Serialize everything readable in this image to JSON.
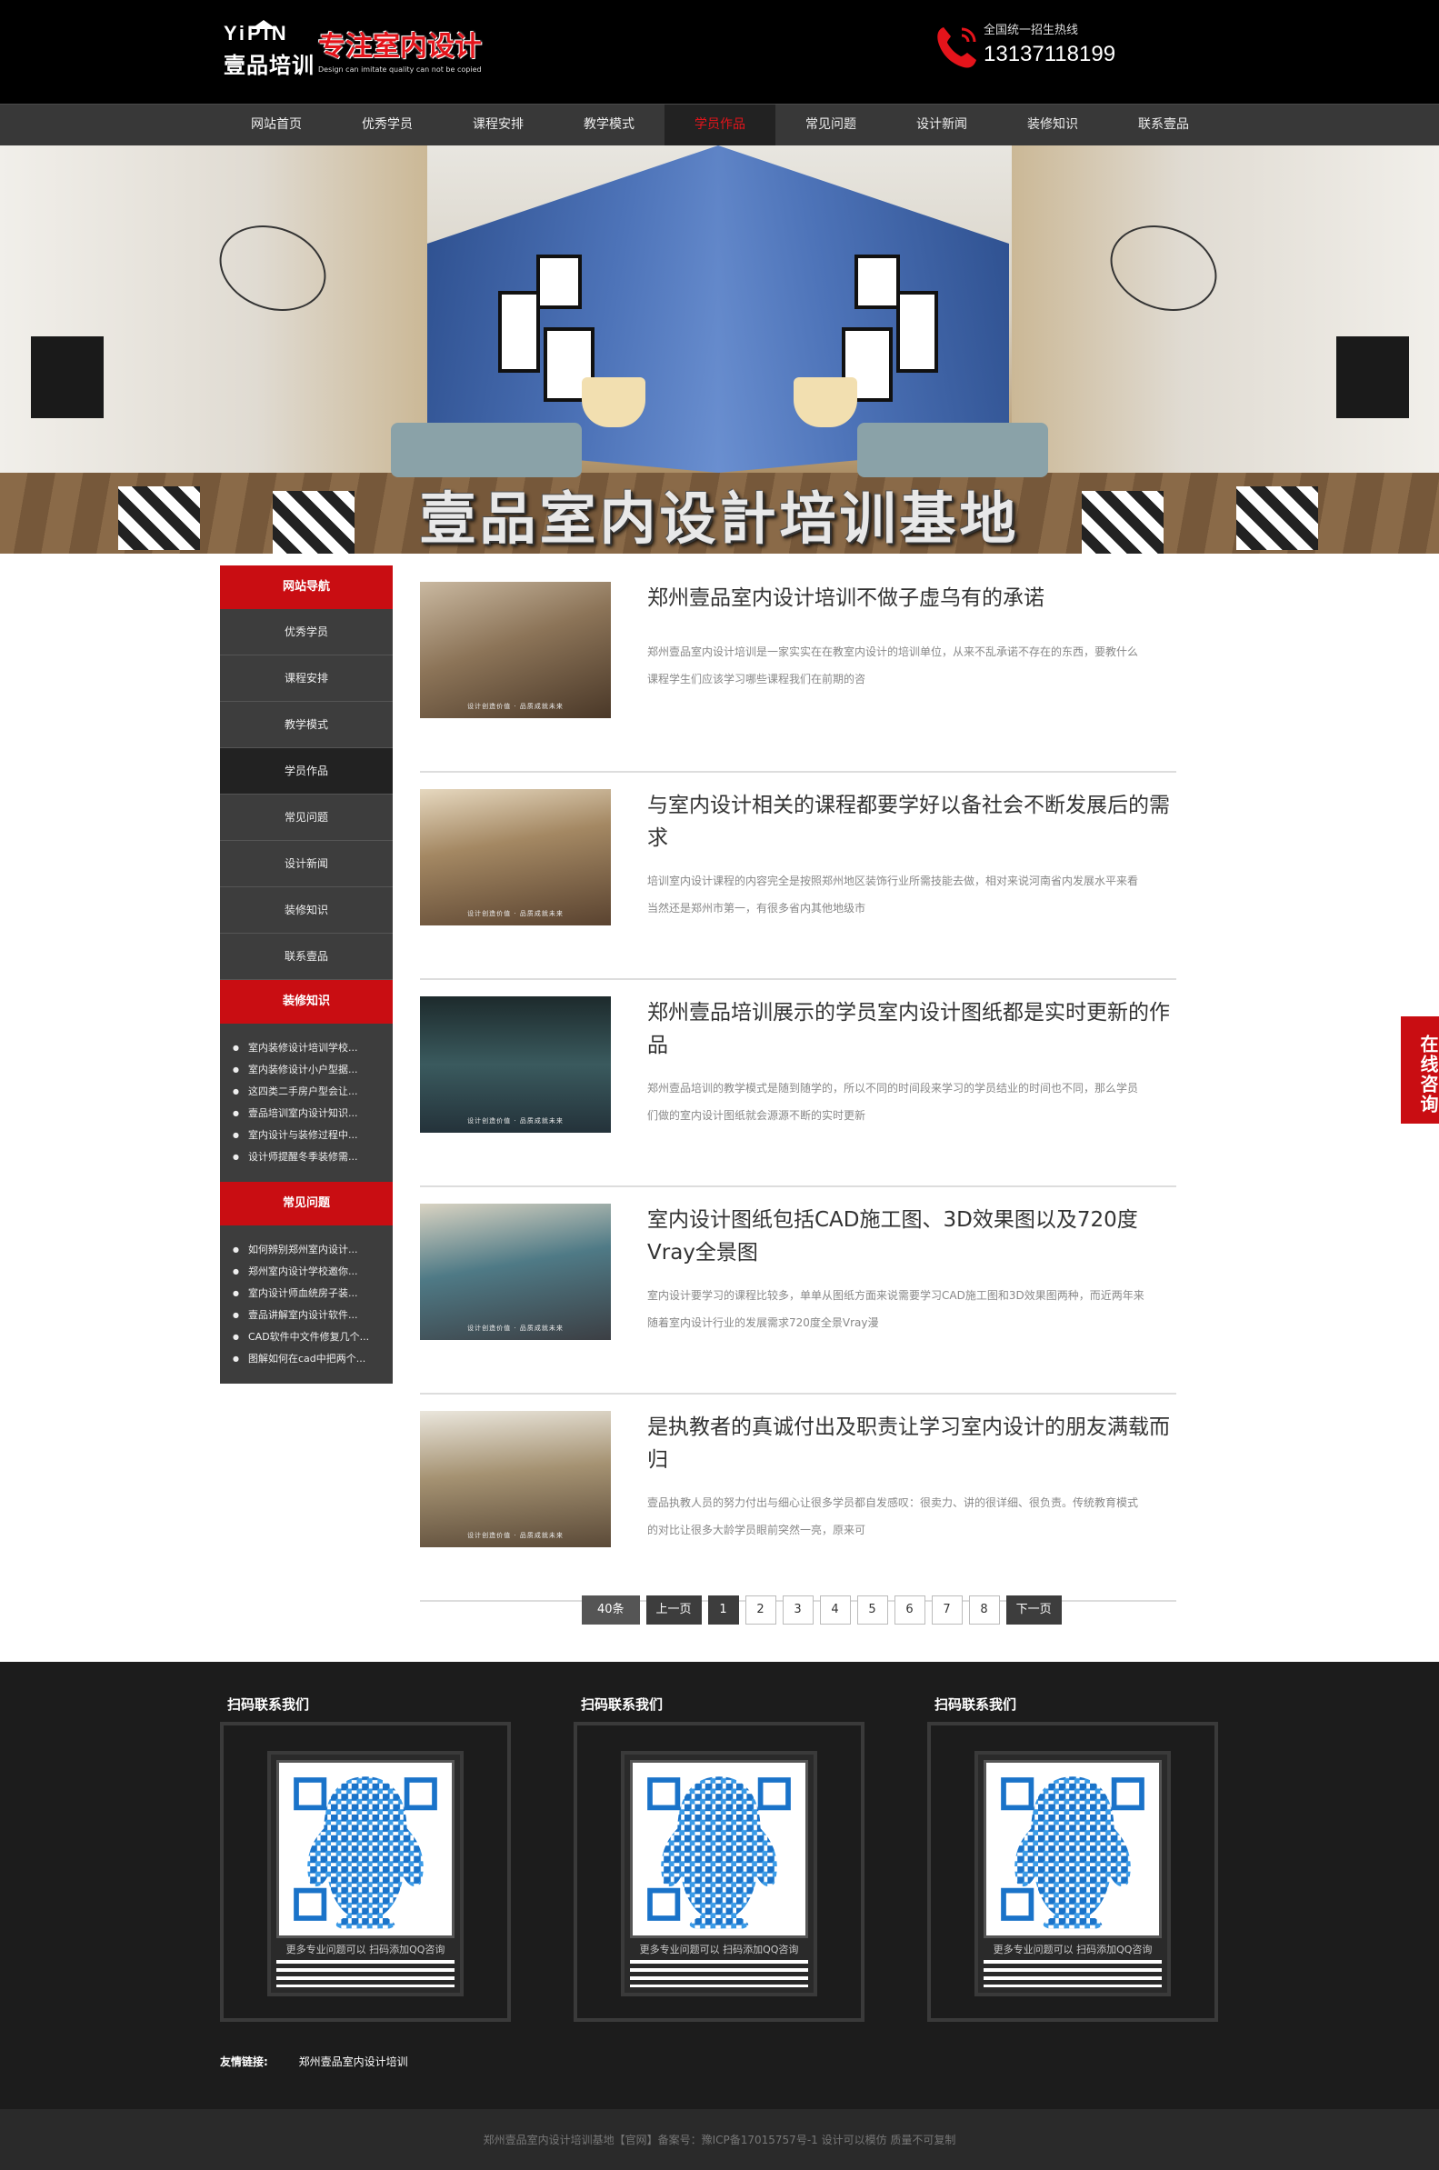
{
  "header": {
    "logo_yp": "YiPiN",
    "logo_cn": "壹品培训",
    "logo_slogan": "专注室内设计",
    "logo_en": "Design can imitate quality can not be copied",
    "hotline_label": "全国统一招生热线",
    "hotline_number": "13137118199"
  },
  "nav": {
    "items": [
      "网站首页",
      "优秀学员",
      "课程安排",
      "教学模式",
      "学员作品",
      "常见问题",
      "设计新闻",
      "装修知识",
      "联系壹品"
    ],
    "active": 4
  },
  "banner": {
    "title": "壹品室内设計培训基地"
  },
  "sidebar": {
    "nav_head": "网站导航",
    "nav_items": [
      "优秀学员",
      "课程安排",
      "教学模式",
      "学员作品",
      "常见问题",
      "设计新闻",
      "装修知识",
      "联系壹品"
    ],
    "nav_active": 3,
    "knowledge_head": "装修知识",
    "knowledge_items": [
      "室内装修设计培训学校...",
      "室内装修设计小户型据...",
      "这四类二手房户型会让...",
      "壹品培训室内设计知识...",
      "室内设计与装修过程中...",
      "设计师提醒冬季装修需..."
    ],
    "faq_head": "常见问题",
    "faq_items": [
      "如何辨别郑州室内设计...",
      "郑州室内设计学校邀你...",
      "室内设计师血统房子装...",
      "壹品讲解室内设计软件...",
      "CAD软件中文件修复几个...",
      "图解如何在cad中把两个..."
    ]
  },
  "articles": [
    {
      "title": "郑州壹品室内设计培训不做子虚乌有的承诺",
      "desc": "郑州壹品室内设计培训是一家实实在在教室内设计的培训单位，从来不乱承诺不存在的东西，要教什么课程学生们应该学习哪些课程我们在前期的咨",
      "thumb_caption": "设计创造价值 · 品质成就未来"
    },
    {
      "title": "与室内设计相关的课程都要学好以备社会不断发展后的需求",
      "desc": "培训室内设计课程的内容完全是按照郑州地区装饰行业所需技能去做，相对来说河南省内发展水平来看当然还是郑州市第一，有很多省内其他地级市",
      "thumb_caption": "设计创造价值 · 品质成就未来"
    },
    {
      "title": "郑州壹品培训展示的学员室内设计图纸都是实时更新的作品",
      "desc": "郑州壹品培训的教学模式是随到随学的，所以不同的时间段来学习的学员结业的时间也不同，那么学员们做的室内设计图纸就会源源不断的实时更新",
      "thumb_caption": "设计创造价值 · 品质成就未来"
    },
    {
      "title": "室内设计图纸包括CAD施工图、3D效果图以及720度Vray全景图",
      "desc": "室内设计要学习的课程比较多，单单从图纸方面来说需要学习CAD施工图和3D效果图两种，而近两年来随着室内设计行业的发展需求720度全景Vray漫",
      "thumb_caption": "设计创造价值 · 品质成就未来"
    },
    {
      "title": "是执教者的真诚付出及职责让学习室内设计的朋友满载而归",
      "desc": "壹品执教人员的努力付出与细心让很多学员都自发感叹：很卖力、讲的很详细、很负责。传统教育模式的对比让很多大龄学员眼前突然一亮，原来可",
      "thumb_caption": "设计创造价值 · 品质成就未来"
    }
  ],
  "pager": {
    "total": "40条",
    "prev": "上一页",
    "pages": [
      "1",
      "2",
      "3",
      "4",
      "5",
      "6",
      "7",
      "8"
    ],
    "current": "1",
    "next": "下一页"
  },
  "footer": {
    "qr_boxes": [
      {
        "title": "扫码联系我们",
        "caption": "更多专业问题可以  扫码添加QQ咨询"
      },
      {
        "title": "扫码联系我们",
        "caption": "更多专业问题可以  扫码添加QQ咨询"
      },
      {
        "title": "扫码联系我们",
        "caption": "更多专业问题可以  扫码添加QQ咨询"
      }
    ],
    "friend_label": "友情链接:",
    "friend_link": "郑州壹品室内设计培训",
    "copyright": "郑州壹品室内设计培训基地【官网】备案号：豫ICP备17015757号-1 设计可以模仿 质量不可复制"
  },
  "consult": {
    "label": "在线咨询"
  },
  "colors": {
    "accent": "#c90d12",
    "header_bg": "#000000",
    "nav_bg": "#383838",
    "sidebar_bg": "#3d3d3d",
    "footer_bg": "#1c1c1c"
  }
}
